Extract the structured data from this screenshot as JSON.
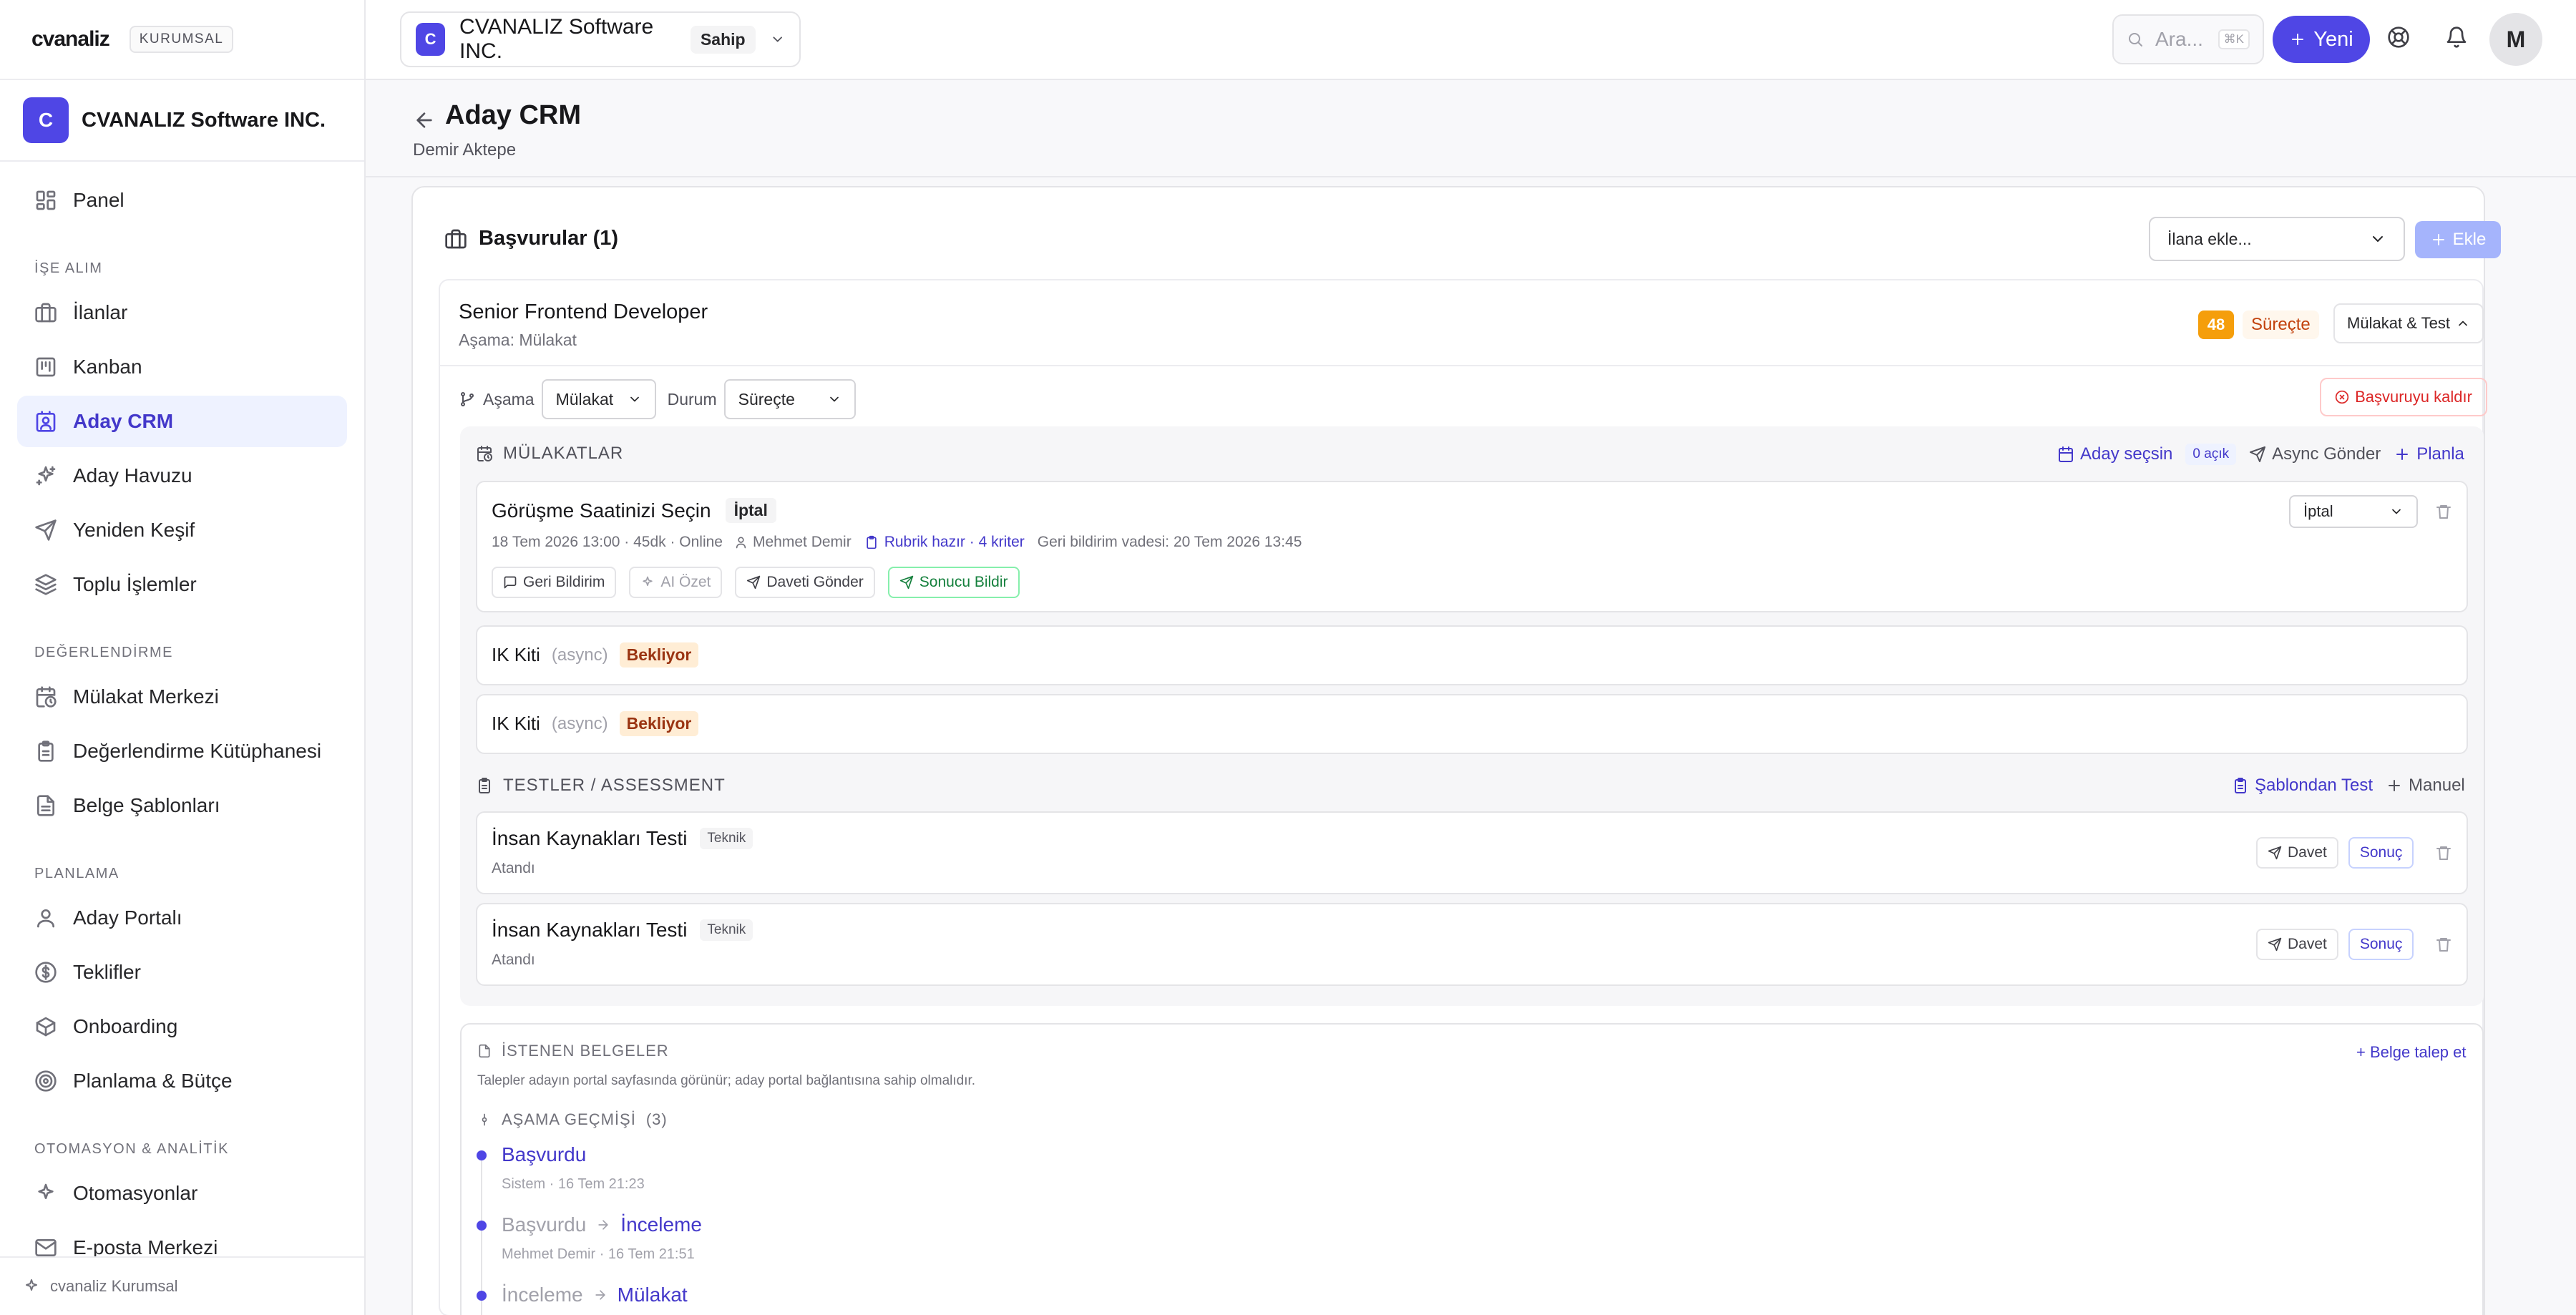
{
  "brand": {
    "logo": "cvanaliz",
    "plan_badge": "KURUMSAL"
  },
  "org": {
    "initial": "C",
    "name": "CVANALIZ Software INC.",
    "role": "Sahip"
  },
  "sidebar": {
    "top": [
      {
        "label": "Panel"
      }
    ],
    "sections": [
      {
        "title": "İŞE ALIM",
        "items": [
          {
            "label": "İlanlar"
          },
          {
            "label": "Kanban"
          },
          {
            "label": "Aday CRM"
          },
          {
            "label": "Aday Havuzu"
          },
          {
            "label": "Yeniden Keşif"
          },
          {
            "label": "Toplu İşlemler"
          }
        ]
      },
      {
        "title": "DEĞERLENDİRME",
        "items": [
          {
            "label": "Mülakat Merkezi"
          },
          {
            "label": "Değerlendirme Kütüphanesi"
          },
          {
            "label": "Belge Şablonları"
          }
        ]
      },
      {
        "title": "PLANLAMA",
        "items": [
          {
            "label": "Aday Portalı"
          },
          {
            "label": "Teklifler"
          },
          {
            "label": "Onboarding"
          },
          {
            "label": "Planlama & Bütçe"
          }
        ]
      },
      {
        "title": "OTOMASYON & ANALİTİK",
        "items": [
          {
            "label": "Otomasyonlar"
          },
          {
            "label": "E-posta Merkezi"
          }
        ]
      }
    ],
    "active": "Aday CRM",
    "footer": "cvanaliz Kurumsal"
  },
  "header": {
    "search_placeholder": "Ara...",
    "search_shortcut": "⌘K",
    "new_label": "Yeni",
    "avatar_initial": "M"
  },
  "page": {
    "title": "Aday CRM",
    "subtitle": "Demir Aktepe"
  },
  "applications": {
    "title": "Başvurular (1)",
    "job_select_placeholder": "İlana ekle...",
    "add_label": "Ekle"
  },
  "application": {
    "job_title": "Senior Frontend Developer",
    "stage_line": "Aşama: Mülakat",
    "score": "48",
    "status": "Süreçte",
    "toggle_label": "Mülakat & Test",
    "stage_label": "Aşama",
    "stage_value": "Mülakat",
    "status_label": "Durum",
    "status_value": "Süreçte",
    "remove_label": "Başvuruyu kaldır"
  },
  "interviews": {
    "title": "MÜLAKATLAR",
    "select_candidate": "Aday seçsin",
    "open_count": "0 açık",
    "async_send": "Async Gönder",
    "plan": "Planla",
    "main": {
      "title": "Görüşme Saatinizi Seçin",
      "badge": "İptal",
      "when": "18 Tem 2026 13:00 · 45dk · Online",
      "interviewer": "Mehmet Demir",
      "rubric": "Rubrik hazır · 4 kriter",
      "feedback_due": "Geri bildirim vadesi: 20 Tem 2026 13:45",
      "status_select": "İptal",
      "actions": {
        "feedback": "Geri Bildirim",
        "ai": "AI Özet",
        "invite": "Daveti Gönder",
        "notify": "Sonucu Bildir"
      }
    },
    "async_items": [
      {
        "title": "IK Kiti",
        "kind": "(async)",
        "status": "Bekliyor"
      },
      {
        "title": "IK Kiti",
        "kind": "(async)",
        "status": "Bekliyor"
      }
    ]
  },
  "tests": {
    "title": "TESTLER / ASSESSMENT",
    "from_template": "Şablondan Test",
    "manual": "Manuel",
    "items": [
      {
        "title": "İnsan Kaynakları Testi",
        "tag": "Teknik",
        "status": "Atandı",
        "invite": "Davet",
        "result": "Sonuç"
      },
      {
        "title": "İnsan Kaynakları Testi",
        "tag": "Teknik",
        "status": "Atandı",
        "invite": "Davet",
        "result": "Sonuç"
      }
    ]
  },
  "documents": {
    "title": "İSTENEN BELGELER",
    "request": "+ Belge talep et",
    "hint": "Talepler adayın portal sayfasında görünür; aday portal bağlantısına sahip olmalıdır."
  },
  "history": {
    "title": "AŞAMA GEÇMİŞİ",
    "count": "(3)",
    "items": [
      {
        "from": "",
        "to": "Başvurdu",
        "meta": "Sistem · 16 Tem 21:23"
      },
      {
        "from": "Başvurdu",
        "to": "İnceleme",
        "meta": "Mehmet Demir · 16 Tem 21:51"
      },
      {
        "from": "İnceleme",
        "to": "Mülakat",
        "meta": ""
      }
    ]
  },
  "colors": {
    "accent": "#4f46e5",
    "warning": "#f59e0b",
    "danger": "#dc2626",
    "success": "#15803d"
  }
}
